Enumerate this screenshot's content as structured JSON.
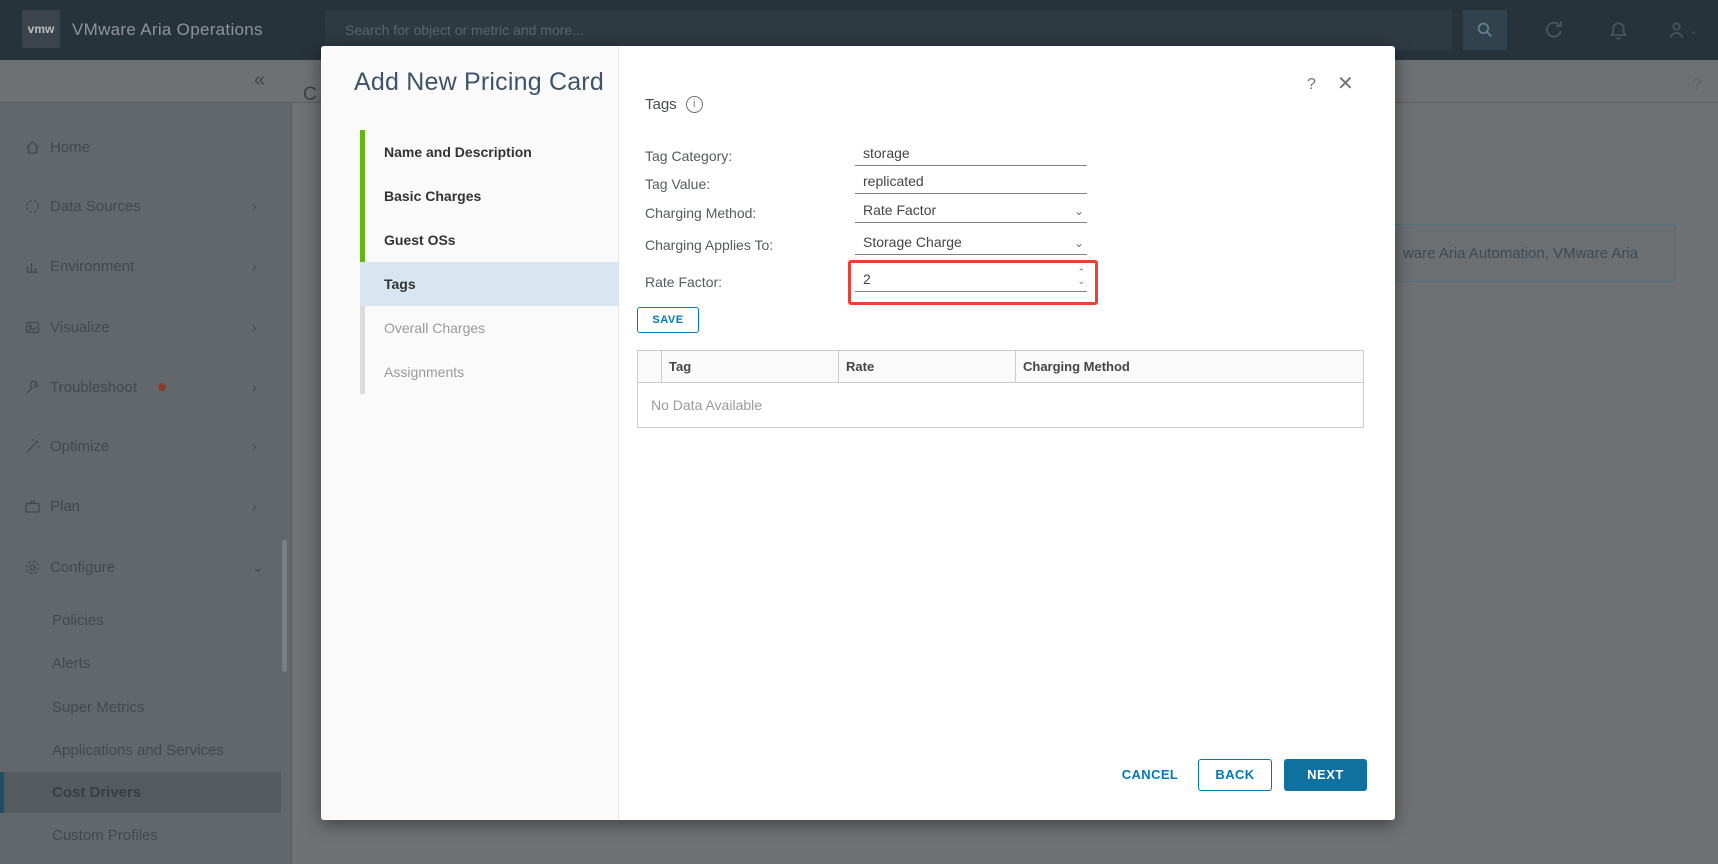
{
  "icons": {
    "chevron_right": "›",
    "chevron_down": "⌄",
    "collapse": "«",
    "help": "?",
    "close": "✕",
    "select_caret": "⌄",
    "spinner_up": "⌃",
    "spinner_down": "⌄",
    "info": "i"
  },
  "header": {
    "logo": "vmw",
    "app_title": "VMware Aria Operations",
    "search_placeholder": "Search for object or metric and more..."
  },
  "sidebar": {
    "items": [
      {
        "label": "Home"
      },
      {
        "label": "Data Sources"
      },
      {
        "label": "Environment"
      },
      {
        "label": "Visualize"
      },
      {
        "label": "Troubleshoot"
      },
      {
        "label": "Optimize"
      },
      {
        "label": "Plan"
      },
      {
        "label": "Configure"
      }
    ],
    "configure_children": [
      "Policies",
      "Alerts",
      "Super Metrics",
      "Applications and Services",
      "Cost Drivers",
      "Custom Profiles"
    ],
    "selected_item": "Cost Drivers"
  },
  "page_background": {
    "title_visible_part": "C",
    "clipped_card_text": "ware Aria Automation, VMware Aria"
  },
  "modal": {
    "title": "Add New Pricing Card",
    "steps": [
      {
        "label": "Name and Description",
        "state": "done"
      },
      {
        "label": "Basic Charges",
        "state": "done"
      },
      {
        "label": "Guest OSs",
        "state": "done"
      },
      {
        "label": "Tags",
        "state": "active"
      },
      {
        "label": "Overall Charges",
        "state": "todo"
      },
      {
        "label": "Assignments",
        "state": "todo"
      }
    ],
    "tags_section": {
      "heading": "Tags",
      "fields": [
        {
          "label": "Tag Category:",
          "value": "storage"
        },
        {
          "label": "Tag Value:",
          "value": "replicated"
        },
        {
          "label": "Charging Method:",
          "value": "Rate Factor"
        },
        {
          "label": "Charging Applies To:",
          "value": "Storage Charge"
        },
        {
          "label": "Rate Factor:",
          "value": "2"
        }
      ],
      "save_button": "SAVE",
      "table": {
        "headers": [
          "Tag",
          "Rate",
          "Charging Method"
        ],
        "empty_message": "No Data Available",
        "rows": []
      }
    },
    "footer": {
      "cancel_button": "CANCEL",
      "back_button": "BACK",
      "next_button": "NEXT"
    }
  },
  "colors": {
    "accent_blue": "#0079b8",
    "primary_button_bg": "#10709f",
    "step_done_green": "#61b715",
    "active_step_bg": "#d7e6f0",
    "highlight_red": "#ee4032",
    "header_bg": "#27333a"
  }
}
